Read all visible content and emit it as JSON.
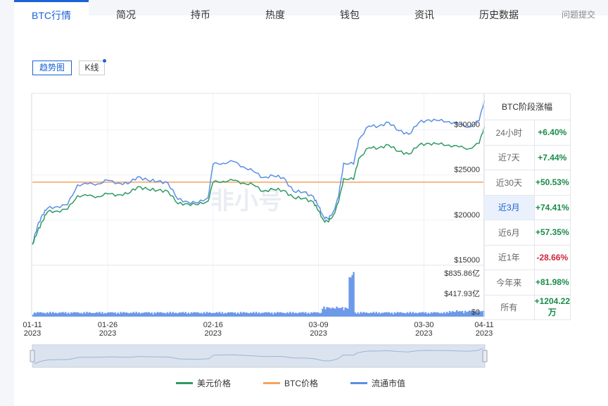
{
  "tabs": [
    {
      "label": "BTC行情",
      "active": true
    },
    {
      "label": "简况"
    },
    {
      "label": "持币"
    },
    {
      "label": "热度"
    },
    {
      "label": "钱包"
    },
    {
      "label": "资讯"
    },
    {
      "label": "历史数据"
    },
    {
      "label": "问题提交"
    }
  ],
  "chart_buttons": {
    "trend": "趋势图",
    "kline": "K线"
  },
  "watermark": "非小号",
  "colors": {
    "usd": "#2e9a62",
    "btc": "#f5a25d",
    "market": "#5b8ee6",
    "accent": "#1a62d6"
  },
  "stats": {
    "header": "BTC阶段涨幅",
    "rows": [
      {
        "label": "24小时",
        "value": "+6.40%"
      },
      {
        "label": "近7天",
        "value": "+7.44%"
      },
      {
        "label": "近30天",
        "value": "+50.53%"
      },
      {
        "label": "近3月",
        "value": "+74.41%"
      },
      {
        "label": "近6月",
        "value": "+57.35%"
      },
      {
        "label": "近1年",
        "value": "-28.66%"
      },
      {
        "label": "今年来",
        "value": "+81.98%"
      },
      {
        "label": "所有",
        "value": "+1204.22万"
      }
    ]
  },
  "chart_data": {
    "type": "line",
    "x_ticks": [
      {
        "date": "2023-01-11",
        "label": "01-11",
        "year": "2023"
      },
      {
        "date": "2023-01-26",
        "label": "01-26",
        "year": "2023"
      },
      {
        "date": "2023-02-16",
        "label": "02-16",
        "year": "2023"
      },
      {
        "date": "2023-03-09",
        "label": "03-09",
        "year": "2023"
      },
      {
        "date": "2023-03-30",
        "label": "03-30",
        "year": "2023"
      },
      {
        "date": "2023-04-11",
        "label": "04-11",
        "year": "2023"
      }
    ],
    "y_ticks": [
      "$30000",
      "$25000",
      "$20000",
      "$15000"
    ],
    "y_tick_values": [
      30000,
      25000,
      20000,
      15000
    ],
    "ylim": [
      15000,
      34000
    ],
    "volume_ticks": [
      "$835.86亿",
      "$417.93亿",
      "$0"
    ],
    "volume_tick_values": [
      835.86,
      417.93,
      0
    ],
    "btc_price_level": 24200,
    "series": [
      {
        "name": "美元价格",
        "key": "usd",
        "points": [
          [
            "2023-01-11",
            17300
          ],
          [
            "2023-01-12",
            18700
          ],
          [
            "2023-01-13",
            19900
          ],
          [
            "2023-01-14",
            20900
          ],
          [
            "2023-01-16",
            21000
          ],
          [
            "2023-01-18",
            21200
          ],
          [
            "2023-01-20",
            22700
          ],
          [
            "2023-01-22",
            22700
          ],
          [
            "2023-01-24",
            22600
          ],
          [
            "2023-01-26",
            22900
          ],
          [
            "2023-01-28",
            22800
          ],
          [
            "2023-01-30",
            22900
          ],
          [
            "2023-02-01",
            23700
          ],
          [
            "2023-02-03",
            23400
          ],
          [
            "2023-02-05",
            23300
          ],
          [
            "2023-02-07",
            23200
          ],
          [
            "2023-02-09",
            21800
          ],
          [
            "2023-02-11",
            21800
          ],
          [
            "2023-02-13",
            21700
          ],
          [
            "2023-02-15",
            22100
          ],
          [
            "2023-02-16",
            24200
          ],
          [
            "2023-02-18",
            24300
          ],
          [
            "2023-02-20",
            24400
          ],
          [
            "2023-02-22",
            24100
          ],
          [
            "2023-02-24",
            23900
          ],
          [
            "2023-02-26",
            23200
          ],
          [
            "2023-02-28",
            23400
          ],
          [
            "2023-03-02",
            23300
          ],
          [
            "2023-03-04",
            22500
          ],
          [
            "2023-03-06",
            22400
          ],
          [
            "2023-03-08",
            22000
          ],
          [
            "2023-03-09",
            21000
          ],
          [
            "2023-03-10",
            20000
          ],
          [
            "2023-03-11",
            19800
          ],
          [
            "2023-03-12",
            20600
          ],
          [
            "2023-03-13",
            22000
          ],
          [
            "2023-03-14",
            24600
          ],
          [
            "2023-03-16",
            24500
          ],
          [
            "2023-03-17",
            26800
          ],
          [
            "2023-03-19",
            28000
          ],
          [
            "2023-03-21",
            28000
          ],
          [
            "2023-03-23",
            28300
          ],
          [
            "2023-03-25",
            27600
          ],
          [
            "2023-03-27",
            27300
          ],
          [
            "2023-03-29",
            28300
          ],
          [
            "2023-03-31",
            28500
          ],
          [
            "2023-04-02",
            28400
          ],
          [
            "2023-04-04",
            28300
          ],
          [
            "2023-04-06",
            28100
          ],
          [
            "2023-04-08",
            27900
          ],
          [
            "2023-04-10",
            28500
          ],
          [
            "2023-04-11",
            30300
          ]
        ]
      },
      {
        "name": "BTC价格",
        "key": "btc"
      },
      {
        "name": "流通市值",
        "key": "market",
        "points": [
          [
            "2023-01-11",
            17300
          ],
          [
            "2023-01-12",
            19300
          ],
          [
            "2023-01-13",
            20600
          ],
          [
            "2023-01-14",
            21300
          ],
          [
            "2023-01-16",
            21500
          ],
          [
            "2023-01-18",
            21700
          ],
          [
            "2023-01-20",
            23900
          ],
          [
            "2023-01-22",
            24000
          ],
          [
            "2023-01-24",
            24000
          ],
          [
            "2023-01-26",
            24400
          ],
          [
            "2023-01-28",
            24100
          ],
          [
            "2023-01-30",
            24000
          ],
          [
            "2023-02-01",
            24800
          ],
          [
            "2023-02-03",
            24400
          ],
          [
            "2023-02-05",
            24300
          ],
          [
            "2023-02-07",
            24100
          ],
          [
            "2023-02-09",
            22300
          ],
          [
            "2023-02-11",
            22000
          ],
          [
            "2023-02-13",
            21900
          ],
          [
            "2023-02-15",
            22500
          ],
          [
            "2023-02-16",
            26200
          ],
          [
            "2023-02-18",
            26300
          ],
          [
            "2023-02-20",
            26500
          ],
          [
            "2023-02-22",
            25900
          ],
          [
            "2023-02-24",
            25400
          ],
          [
            "2023-02-26",
            24700
          ],
          [
            "2023-02-28",
            24900
          ],
          [
            "2023-03-02",
            24700
          ],
          [
            "2023-03-04",
            23200
          ],
          [
            "2023-03-06",
            23100
          ],
          [
            "2023-03-08",
            22600
          ],
          [
            "2023-03-09",
            21500
          ],
          [
            "2023-03-10",
            20400
          ],
          [
            "2023-03-11",
            20100
          ],
          [
            "2023-03-12",
            21000
          ],
          [
            "2023-03-13",
            22600
          ],
          [
            "2023-03-14",
            26300
          ],
          [
            "2023-03-16",
            26200
          ],
          [
            "2023-03-17",
            28900
          ],
          [
            "2023-03-19",
            30400
          ],
          [
            "2023-03-21",
            30400
          ],
          [
            "2023-03-23",
            30800
          ],
          [
            "2023-03-25",
            29900
          ],
          [
            "2023-03-27",
            29500
          ],
          [
            "2023-03-29",
            30800
          ],
          [
            "2023-03-31",
            31100
          ],
          [
            "2023-04-02",
            31000
          ],
          [
            "2023-04-04",
            30900
          ],
          [
            "2023-04-06",
            30600
          ],
          [
            "2023-04-08",
            30300
          ],
          [
            "2023-04-10",
            31000
          ],
          [
            "2023-04-11",
            33200
          ]
        ]
      }
    ],
    "legend": [
      "美元价格",
      "BTC价格",
      "流通市值"
    ],
    "legend_placement": "bottom"
  }
}
